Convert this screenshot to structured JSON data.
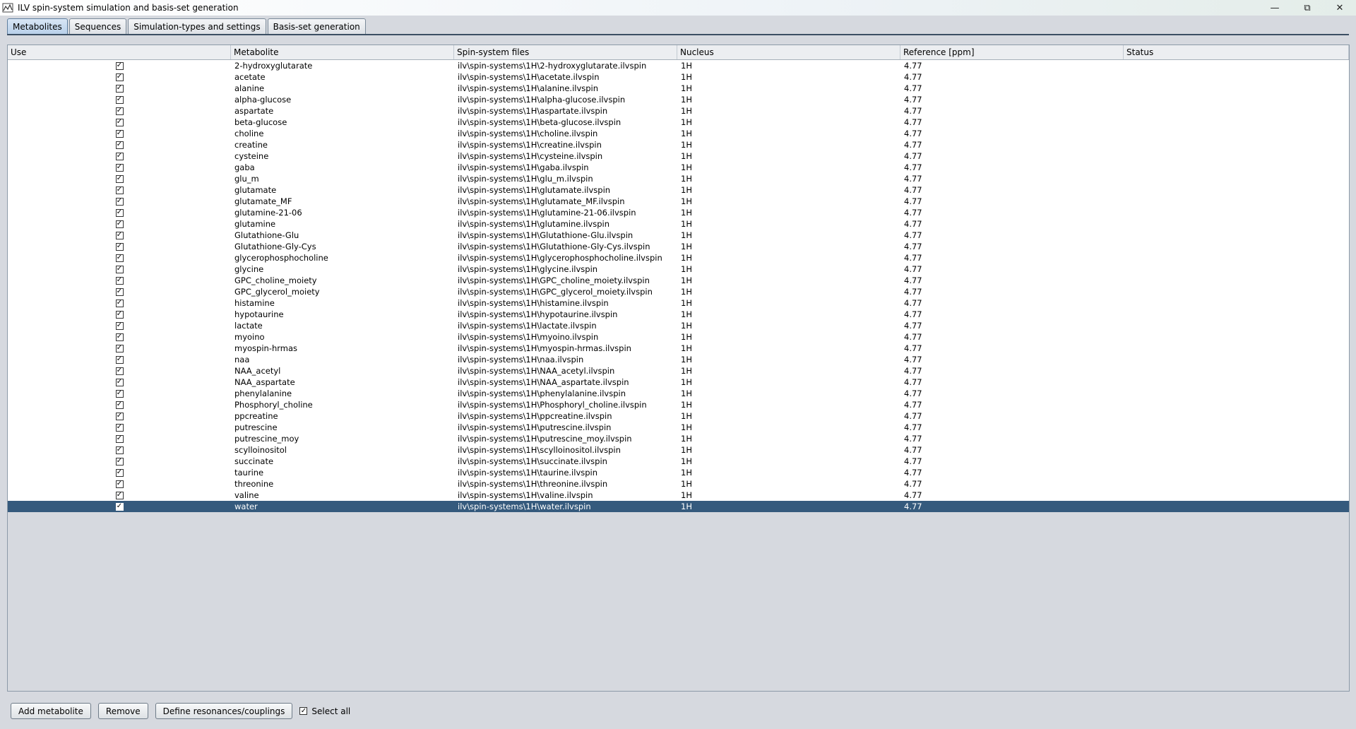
{
  "window": {
    "title": "ILV spin-system simulation and basis-set generation",
    "minimize_icon": "minimize-icon",
    "restore_icon": "restore-icon",
    "close_icon": "close-icon"
  },
  "tabs": [
    {
      "label": "Metabolites",
      "active": true
    },
    {
      "label": "Sequences",
      "active": false
    },
    {
      "label": "Simulation-types and settings",
      "active": false
    },
    {
      "label": "Basis-set generation",
      "active": false
    }
  ],
  "table": {
    "columns": [
      "Use",
      "Metabolite",
      "Spin-system files",
      "Nucleus",
      "Reference [ppm]",
      "Status"
    ],
    "rows": [
      {
        "use": true,
        "metabolite": "2-hydroxyglutarate",
        "file": "ilv\\spin-systems\\1H\\2-hydroxyglutarate.ilvspin",
        "nucleus": "1H",
        "reference": "4.77",
        "status": ""
      },
      {
        "use": true,
        "metabolite": "acetate",
        "file": "ilv\\spin-systems\\1H\\acetate.ilvspin",
        "nucleus": "1H",
        "reference": "4.77",
        "status": ""
      },
      {
        "use": true,
        "metabolite": "alanine",
        "file": "ilv\\spin-systems\\1H\\alanine.ilvspin",
        "nucleus": "1H",
        "reference": "4.77",
        "status": ""
      },
      {
        "use": true,
        "metabolite": "alpha-glucose",
        "file": "ilv\\spin-systems\\1H\\alpha-glucose.ilvspin",
        "nucleus": "1H",
        "reference": "4.77",
        "status": ""
      },
      {
        "use": true,
        "metabolite": "aspartate",
        "file": "ilv\\spin-systems\\1H\\aspartate.ilvspin",
        "nucleus": "1H",
        "reference": "4.77",
        "status": ""
      },
      {
        "use": true,
        "metabolite": "beta-glucose",
        "file": "ilv\\spin-systems\\1H\\beta-glucose.ilvspin",
        "nucleus": "1H",
        "reference": "4.77",
        "status": ""
      },
      {
        "use": true,
        "metabolite": "choline",
        "file": "ilv\\spin-systems\\1H\\choline.ilvspin",
        "nucleus": "1H",
        "reference": "4.77",
        "status": ""
      },
      {
        "use": true,
        "metabolite": "creatine",
        "file": "ilv\\spin-systems\\1H\\creatine.ilvspin",
        "nucleus": "1H",
        "reference": "4.77",
        "status": ""
      },
      {
        "use": true,
        "metabolite": "cysteine",
        "file": "ilv\\spin-systems\\1H\\cysteine.ilvspin",
        "nucleus": "1H",
        "reference": "4.77",
        "status": ""
      },
      {
        "use": true,
        "metabolite": "gaba",
        "file": "ilv\\spin-systems\\1H\\gaba.ilvspin",
        "nucleus": "1H",
        "reference": "4.77",
        "status": ""
      },
      {
        "use": true,
        "metabolite": "glu_m",
        "file": "ilv\\spin-systems\\1H\\glu_m.ilvspin",
        "nucleus": "1H",
        "reference": "4.77",
        "status": ""
      },
      {
        "use": true,
        "metabolite": "glutamate",
        "file": "ilv\\spin-systems\\1H\\glutamate.ilvspin",
        "nucleus": "1H",
        "reference": "4.77",
        "status": ""
      },
      {
        "use": true,
        "metabolite": "glutamate_MF",
        "file": "ilv\\spin-systems\\1H\\glutamate_MF.ilvspin",
        "nucleus": "1H",
        "reference": "4.77",
        "status": ""
      },
      {
        "use": true,
        "metabolite": "glutamine-21-06",
        "file": "ilv\\spin-systems\\1H\\glutamine-21-06.ilvspin",
        "nucleus": "1H",
        "reference": "4.77",
        "status": ""
      },
      {
        "use": true,
        "metabolite": "glutamine",
        "file": "ilv\\spin-systems\\1H\\glutamine.ilvspin",
        "nucleus": "1H",
        "reference": "4.77",
        "status": ""
      },
      {
        "use": true,
        "metabolite": "Glutathione-Glu",
        "file": "ilv\\spin-systems\\1H\\Glutathione-Glu.ilvspin",
        "nucleus": "1H",
        "reference": "4.77",
        "status": ""
      },
      {
        "use": true,
        "metabolite": "Glutathione-Gly-Cys",
        "file": "ilv\\spin-systems\\1H\\Glutathione-Gly-Cys.ilvspin",
        "nucleus": "1H",
        "reference": "4.77",
        "status": ""
      },
      {
        "use": true,
        "metabolite": "glycerophosphocholine",
        "file": "ilv\\spin-systems\\1H\\glycerophosphocholine.ilvspin",
        "nucleus": "1H",
        "reference": "4.77",
        "status": ""
      },
      {
        "use": true,
        "metabolite": "glycine",
        "file": "ilv\\spin-systems\\1H\\glycine.ilvspin",
        "nucleus": "1H",
        "reference": "4.77",
        "status": ""
      },
      {
        "use": true,
        "metabolite": "GPC_choline_moiety",
        "file": "ilv\\spin-systems\\1H\\GPC_choline_moiety.ilvspin",
        "nucleus": "1H",
        "reference": "4.77",
        "status": ""
      },
      {
        "use": true,
        "metabolite": "GPC_glycerol_moiety",
        "file": "ilv\\spin-systems\\1H\\GPC_glycerol_moiety.ilvspin",
        "nucleus": "1H",
        "reference": "4.77",
        "status": ""
      },
      {
        "use": true,
        "metabolite": "histamine",
        "file": "ilv\\spin-systems\\1H\\histamine.ilvspin",
        "nucleus": "1H",
        "reference": "4.77",
        "status": ""
      },
      {
        "use": true,
        "metabolite": "hypotaurine",
        "file": "ilv\\spin-systems\\1H\\hypotaurine.ilvspin",
        "nucleus": "1H",
        "reference": "4.77",
        "status": ""
      },
      {
        "use": true,
        "metabolite": "lactate",
        "file": "ilv\\spin-systems\\1H\\lactate.ilvspin",
        "nucleus": "1H",
        "reference": "4.77",
        "status": ""
      },
      {
        "use": true,
        "metabolite": "myoino",
        "file": "ilv\\spin-systems\\1H\\myoino.ilvspin",
        "nucleus": "1H",
        "reference": "4.77",
        "status": ""
      },
      {
        "use": true,
        "metabolite": "myospin-hrmas",
        "file": "ilv\\spin-systems\\1H\\myospin-hrmas.ilvspin",
        "nucleus": "1H",
        "reference": "4.77",
        "status": ""
      },
      {
        "use": true,
        "metabolite": "naa",
        "file": "ilv\\spin-systems\\1H\\naa.ilvspin",
        "nucleus": "1H",
        "reference": "4.77",
        "status": ""
      },
      {
        "use": true,
        "metabolite": "NAA_acetyl",
        "file": "ilv\\spin-systems\\1H\\NAA_acetyl.ilvspin",
        "nucleus": "1H",
        "reference": "4.77",
        "status": ""
      },
      {
        "use": true,
        "metabolite": "NAA_aspartate",
        "file": "ilv\\spin-systems\\1H\\NAA_aspartate.ilvspin",
        "nucleus": "1H",
        "reference": "4.77",
        "status": ""
      },
      {
        "use": true,
        "metabolite": "phenylalanine",
        "file": "ilv\\spin-systems\\1H\\phenylalanine.ilvspin",
        "nucleus": "1H",
        "reference": "4.77",
        "status": ""
      },
      {
        "use": true,
        "metabolite": "Phosphoryl_choline",
        "file": "ilv\\spin-systems\\1H\\Phosphoryl_choline.ilvspin",
        "nucleus": "1H",
        "reference": "4.77",
        "status": ""
      },
      {
        "use": true,
        "metabolite": "ppcreatine",
        "file": "ilv\\spin-systems\\1H\\ppcreatine.ilvspin",
        "nucleus": "1H",
        "reference": "4.77",
        "status": ""
      },
      {
        "use": true,
        "metabolite": "putrescine",
        "file": "ilv\\spin-systems\\1H\\putrescine.ilvspin",
        "nucleus": "1H",
        "reference": "4.77",
        "status": ""
      },
      {
        "use": true,
        "metabolite": "putrescine_moy",
        "file": "ilv\\spin-systems\\1H\\putrescine_moy.ilvspin",
        "nucleus": "1H",
        "reference": "4.77",
        "status": ""
      },
      {
        "use": true,
        "metabolite": "scylloinositol",
        "file": "ilv\\spin-systems\\1H\\scylloinositol.ilvspin",
        "nucleus": "1H",
        "reference": "4.77",
        "status": ""
      },
      {
        "use": true,
        "metabolite": "succinate",
        "file": "ilv\\spin-systems\\1H\\succinate.ilvspin",
        "nucleus": "1H",
        "reference": "4.77",
        "status": ""
      },
      {
        "use": true,
        "metabolite": "taurine",
        "file": "ilv\\spin-systems\\1H\\taurine.ilvspin",
        "nucleus": "1H",
        "reference": "4.77",
        "status": ""
      },
      {
        "use": true,
        "metabolite": "threonine",
        "file": "ilv\\spin-systems\\1H\\threonine.ilvspin",
        "nucleus": "1H",
        "reference": "4.77",
        "status": ""
      },
      {
        "use": true,
        "metabolite": "valine",
        "file": "ilv\\spin-systems\\1H\\valine.ilvspin",
        "nucleus": "1H",
        "reference": "4.77",
        "status": ""
      },
      {
        "use": true,
        "metabolite": "water",
        "file": "ilv\\spin-systems\\1H\\water.ilvspin",
        "nucleus": "1H",
        "reference": "4.77",
        "status": "",
        "selected": true
      }
    ]
  },
  "bottom": {
    "add_label": "Add metabolite",
    "remove_label": "Remove",
    "define_label": "Define resonances/couplings",
    "select_all_label": "Select all",
    "select_all_checked": true
  },
  "colors": {
    "selection": "#355a7d",
    "background": "#d6d9df"
  }
}
